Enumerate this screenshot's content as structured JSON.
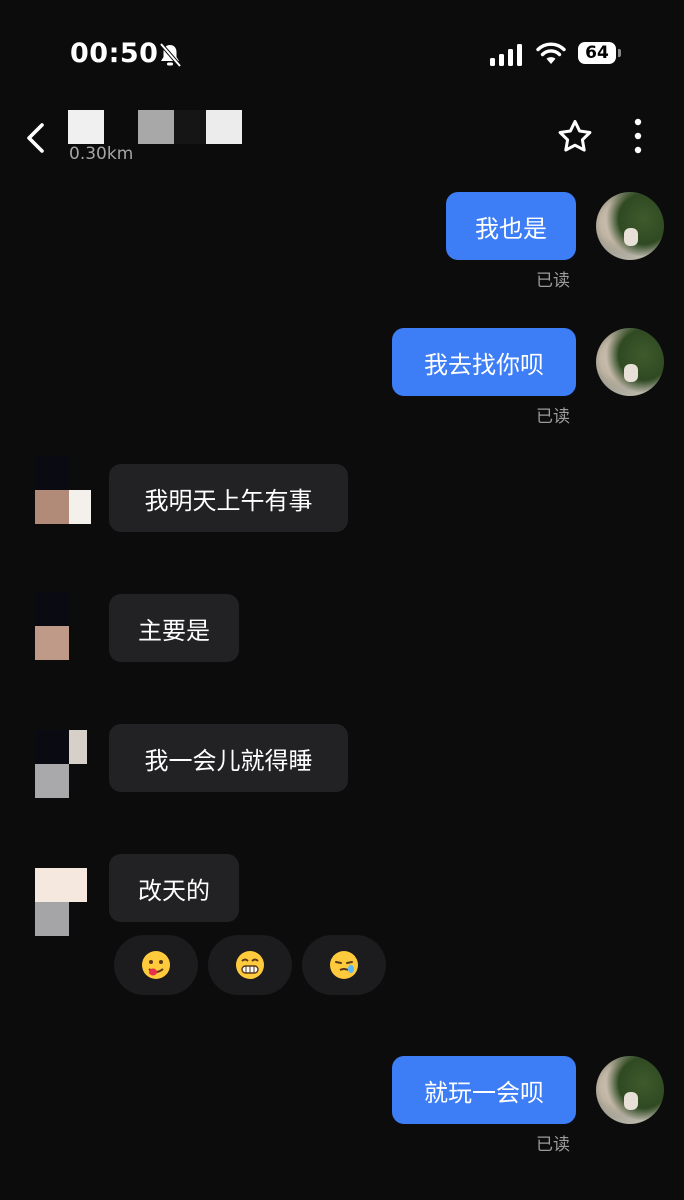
{
  "status_bar": {
    "time": "00:50",
    "battery": "64"
  },
  "header": {
    "distance": "0.30km"
  },
  "messages": [
    {
      "side": "mine",
      "text": "我也是",
      "read": "已读"
    },
    {
      "side": "mine",
      "text": "我去找你呗",
      "read": "已读"
    },
    {
      "side": "theirs",
      "text": "我明天上午有事"
    },
    {
      "side": "theirs",
      "text": "主要是"
    },
    {
      "side": "theirs",
      "text": "我一会儿就得睡"
    },
    {
      "side": "theirs",
      "text": "改天的"
    },
    {
      "side": "mine",
      "text": "就玩一会呗",
      "read": "已读"
    }
  ],
  "reactions": [
    "yum-emoji-icon",
    "grin-emoji-icon",
    "sleepy-emoji-icon"
  ],
  "colors": {
    "my_bubble": "#3d7ef7",
    "their_bubble": "#222224",
    "background": "#0c0c0d"
  }
}
